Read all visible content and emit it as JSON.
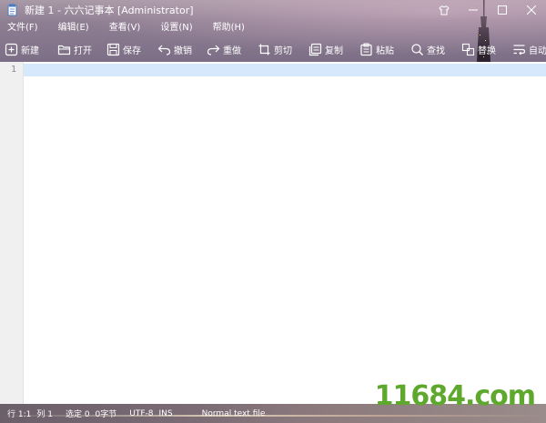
{
  "window": {
    "title": "新建 1 - 六六记事本 [Administrator]"
  },
  "menu": {
    "items": [
      {
        "label": "文件(F)"
      },
      {
        "label": "编辑(E)"
      },
      {
        "label": "查看(V)"
      },
      {
        "label": "设置(N)"
      },
      {
        "label": "帮助(H)"
      }
    ]
  },
  "toolbar": {
    "items": [
      {
        "label": "新建",
        "icon": "new-file-icon"
      },
      {
        "label": "打开",
        "icon": "folder-open-icon"
      },
      {
        "label": "保存",
        "icon": "save-icon"
      },
      {
        "label": "撤销",
        "icon": "undo-icon"
      },
      {
        "label": "重做",
        "icon": "redo-icon"
      },
      {
        "label": "剪切",
        "icon": "cut-icon"
      },
      {
        "label": "复制",
        "icon": "copy-icon"
      },
      {
        "label": "粘贴",
        "icon": "paste-icon"
      },
      {
        "label": "查找",
        "icon": "search-icon"
      },
      {
        "label": "替换",
        "icon": "replace-icon"
      },
      {
        "label": "自动换行",
        "icon": "word-wrap-icon"
      }
    ]
  },
  "editor": {
    "line_numbers": [
      "1"
    ],
    "content": ""
  },
  "status": {
    "position": "行 1:1",
    "column": "列 1",
    "selection": "选定 0",
    "bytes": "0字节",
    "encoding": "UTF-8",
    "insert_mode": "INS",
    "file_type": "Normal text file"
  },
  "watermark": {
    "text": "11684.com"
  },
  "colors": {
    "header_bg": "#8f7f93",
    "current_line": "#d6e8fb",
    "gutter_bg": "#f0f0f0",
    "watermark": "#5fa82e"
  }
}
